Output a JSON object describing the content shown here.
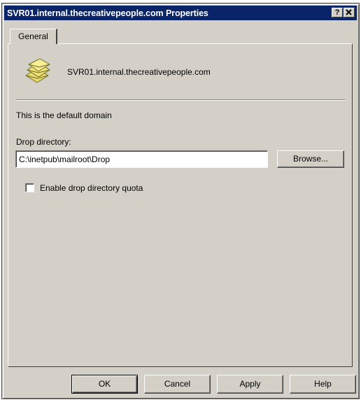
{
  "window": {
    "title": "SVR01.internal.thecreativepeople.com Properties",
    "help_button": "?",
    "close_button": "✕"
  },
  "tabs": [
    {
      "label": "General",
      "active": true
    }
  ],
  "general": {
    "domain_name": "SVR01.internal.thecreativepeople.com",
    "default_domain_text": "This is the default domain",
    "drop_directory_label": "Drop directory:",
    "drop_directory_value": "C:\\inetpub\\mailroot\\Drop",
    "browse_label": "Browse...",
    "quota_checkbox_label": "Enable drop directory quota",
    "quota_checked": false
  },
  "footer": {
    "ok_label": "OK",
    "cancel_label": "Cancel",
    "apply_label": "Apply",
    "help_label": "Help"
  },
  "icons": {
    "domain": "domain-envelopes-icon"
  },
  "colors": {
    "titlebar": "#0a246a",
    "dialog_face": "#d4d0c8"
  }
}
